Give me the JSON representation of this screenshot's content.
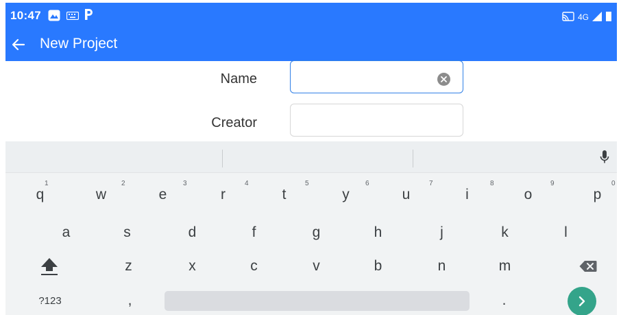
{
  "status_bar": {
    "time": "10:47",
    "network": "4G",
    "icons": [
      "gallery-app-icon",
      "keyboard-notification-icon",
      "p-app-icon",
      "cast-icon",
      "signal-icon",
      "battery-icon"
    ]
  },
  "app_bar": {
    "title": "New Project",
    "back_icon": "arrow-back-icon"
  },
  "form": {
    "name_label": "Name",
    "name_value": "",
    "creator_label": "Creator",
    "creator_value": ""
  },
  "keyboard": {
    "row1": [
      {
        "letter": "q",
        "hint": "1"
      },
      {
        "letter": "w",
        "hint": "2"
      },
      {
        "letter": "e",
        "hint": "3"
      },
      {
        "letter": "r",
        "hint": "4"
      },
      {
        "letter": "t",
        "hint": "5"
      },
      {
        "letter": "y",
        "hint": "6"
      },
      {
        "letter": "u",
        "hint": "7"
      },
      {
        "letter": "i",
        "hint": "8"
      },
      {
        "letter": "o",
        "hint": "9"
      },
      {
        "letter": "p",
        "hint": "0"
      }
    ],
    "row2": [
      "a",
      "s",
      "d",
      "f",
      "g",
      "h",
      "j",
      "k",
      "l"
    ],
    "row3": [
      "z",
      "x",
      "c",
      "v",
      "b",
      "n",
      "m"
    ],
    "symbols_label": "?123",
    "comma": ",",
    "period": ".",
    "icons": [
      "mic-icon",
      "shift-icon",
      "backspace-icon",
      "enter-arrow-icon"
    ]
  },
  "colors": {
    "primary": "#2979ff",
    "focus_border": "#2f7fe6",
    "enter_button": "#34a48a",
    "keyboard_bg": "#f1f3f4"
  }
}
